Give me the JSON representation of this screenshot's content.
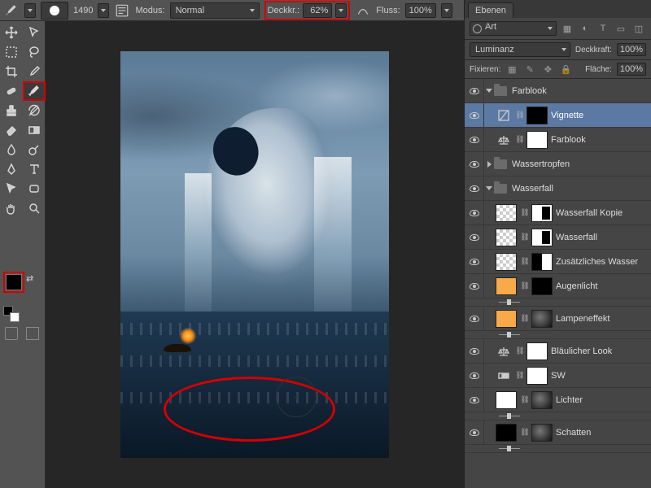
{
  "topbar": {
    "brush_size": "1490",
    "mode_label": "Modus:",
    "mode_value": "Normal",
    "opacity_label": "Deckkr.:",
    "opacity_value": "62%",
    "flow_label": "Fluss:",
    "flow_value": "100%"
  },
  "panel": {
    "tab": "Ebenen",
    "search_kind": "Art",
    "blend_mode": "Luminanz",
    "opacity_label": "Deckkraft:",
    "opacity_value": "100%",
    "lock_label": "Fixieren:",
    "fill_label": "Fläche:",
    "fill_value": "100%"
  },
  "layers": [
    {
      "type": "group",
      "name": "Farblook",
      "expanded": true,
      "depth": 0
    },
    {
      "type": "adj",
      "name": "Vignette",
      "icon": "curves",
      "mask": "mask-dark",
      "depth": 1,
      "selected": true
    },
    {
      "type": "adj",
      "name": "Farblook",
      "icon": "balance",
      "mask": "mask",
      "depth": 1
    },
    {
      "type": "group",
      "name": "Wassertropfen",
      "expanded": false,
      "depth": 0
    },
    {
      "type": "group",
      "name": "Wasserfall",
      "expanded": true,
      "depth": 0
    },
    {
      "type": "pixel",
      "name": "Wasserfall Kopie",
      "thumb": "checker",
      "mask": "bw",
      "depth": 1,
      "linked": true
    },
    {
      "type": "pixel",
      "name": "Wasserfall",
      "thumb": "checker",
      "mask": "bw",
      "depth": 1,
      "linked": true
    },
    {
      "type": "pixel",
      "name": "Zusätzliches Wasser",
      "thumb": "checker",
      "mask": "half",
      "depth": 1,
      "linked": true
    },
    {
      "type": "fill",
      "name": "Augenlicht",
      "thumb": "orange",
      "mask": "mask-dark",
      "depth": 1,
      "slider": true,
      "linked": true
    },
    {
      "type": "fill",
      "name": "Lampeneffekt",
      "thumb": "orange",
      "mask": "blur",
      "depth": 1,
      "slider": true,
      "linked": true
    },
    {
      "type": "adj",
      "name": "Bläulicher Look",
      "icon": "balance",
      "mask": "mask",
      "depth": 1
    },
    {
      "type": "adj",
      "name": "SW",
      "icon": "grad",
      "mask": "mask",
      "depth": 1
    },
    {
      "type": "fill",
      "name": "Lichter",
      "thumb": "mask",
      "mask": "blur",
      "depth": 1,
      "slider": true,
      "linked": true
    },
    {
      "type": "fill",
      "name": "Schatten",
      "thumb": "mask-dark",
      "mask": "blur",
      "depth": 1,
      "slider": true,
      "linked": true
    }
  ]
}
